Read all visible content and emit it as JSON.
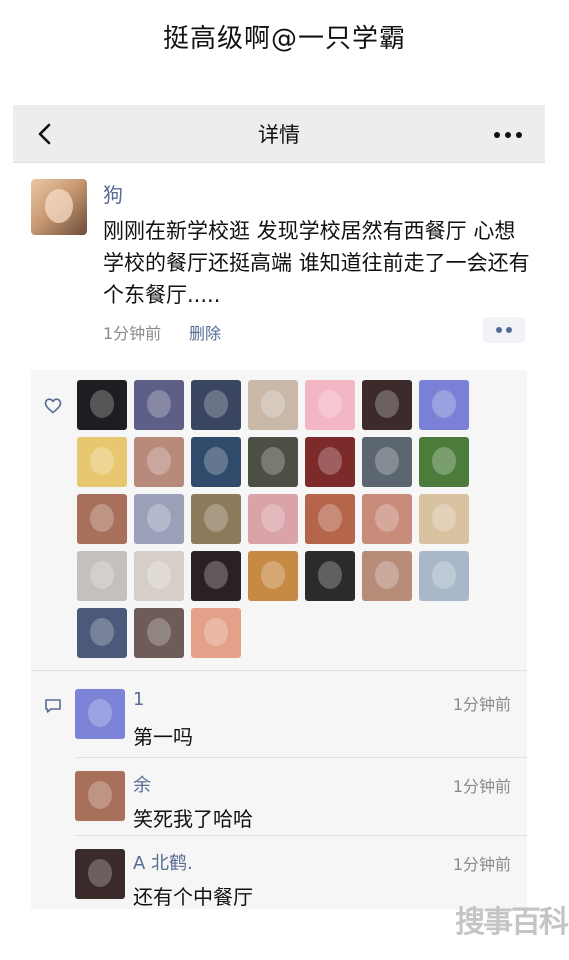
{
  "caption": "挺高级啊@一只学霸",
  "navbar": {
    "title": "详情"
  },
  "post": {
    "author": "狗",
    "text": "刚刚在新学校逛 发现学校居然有西餐厅 心想学校的餐厅还挺高端 谁知道往前走了一会还有个东餐厅.....",
    "time": "1分钟前",
    "delete_label": "删除"
  },
  "likers": [
    {
      "color": "#1e1e22"
    },
    {
      "color": "#5d5f86"
    },
    {
      "color": "#3a4560"
    },
    {
      "color": "#c9b7a8"
    },
    {
      "color": "#f2b6c4"
    },
    {
      "color": "#3d2b2b"
    },
    {
      "color": "#7a80d6"
    },
    {
      "color": "#e7c76f"
    },
    {
      "color": "#b88a7c"
    },
    {
      "color": "#2f4a6a"
    },
    {
      "color": "#4b4f44"
    },
    {
      "color": "#7c2a2a"
    },
    {
      "color": "#5c6670"
    },
    {
      "color": "#4c7c3c"
    },
    {
      "color": "#a8705a"
    },
    {
      "color": "#9aa0b8"
    },
    {
      "color": "#8c7a5a"
    },
    {
      "color": "#d9a3a8"
    },
    {
      "color": "#b5654a"
    },
    {
      "color": "#c98b7a"
    },
    {
      "color": "#d8c2a0"
    },
    {
      "color": "#c4c0bb"
    },
    {
      "color": "#d6cfc7"
    },
    {
      "color": "#2b2124"
    },
    {
      "color": "#c68a45"
    },
    {
      "color": "#2c2a2c"
    },
    {
      "color": "#b78d7a"
    },
    {
      "color": "#a8b8c8"
    },
    {
      "color": "#4b5a7a"
    },
    {
      "color": "#6d5c58"
    },
    {
      "color": "#e2a188"
    }
  ],
  "comments": [
    {
      "name": "1",
      "time": "1分钟前",
      "text": "第一吗",
      "color": "#7d84d8"
    },
    {
      "name": "余",
      "time": "1分钟前",
      "text": "笑死我了哈哈",
      "color": "#a8705a"
    },
    {
      "name": "A 北鹤.",
      "time": "1分钟前",
      "text": "还有个中餐厅",
      "color": "#3a2a2a"
    }
  ],
  "watermark": "搜事百科"
}
